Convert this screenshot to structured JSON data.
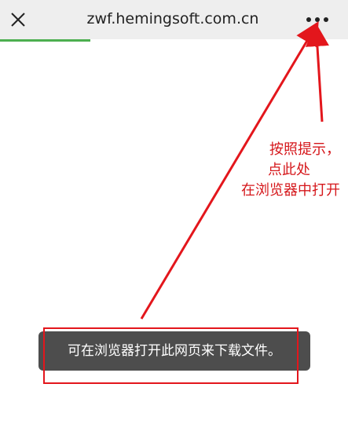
{
  "topbar": {
    "url": "zwf.hemingsoft.com.cn",
    "close_icon": "close-icon",
    "more_icon": "more-horizontal-icon"
  },
  "progress": {
    "fraction": 0.26
  },
  "annotation": {
    "line1": "按照提示，",
    "line2": "点此处",
    "line3": "在浏览器中打开",
    "color": "#d5171b"
  },
  "toast": {
    "message": "可在浏览器打开此网页来下载文件。"
  }
}
